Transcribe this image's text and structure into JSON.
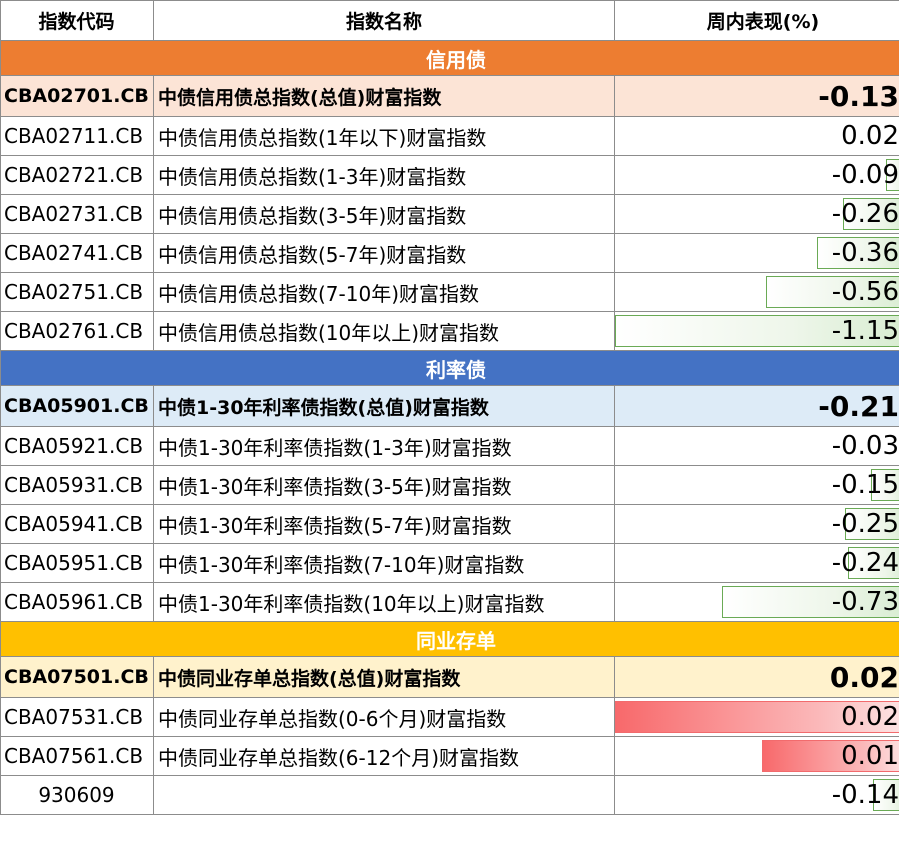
{
  "header": {
    "col_code": "指数代码",
    "col_name": "指数名称",
    "col_perf": "周内表现(%)"
  },
  "sections": [
    {
      "title": "信用债",
      "total": {
        "code": "CBA02701.CB",
        "name": "中债信用债总指数(总值)财富指数",
        "value": "-0.13"
      },
      "rows": [
        {
          "code": "CBA02711.CB",
          "name": "中债信用债总指数(1年以下)财富指数",
          "value": "0.02",
          "num": 0.02
        },
        {
          "code": "CBA02721.CB",
          "name": "中债信用债总指数(1-3年)财富指数",
          "value": "-0.09",
          "num": -0.09
        },
        {
          "code": "CBA02731.CB",
          "name": "中债信用债总指数(3-5年)财富指数",
          "value": "-0.26",
          "num": -0.26
        },
        {
          "code": "CBA02741.CB",
          "name": "中债信用债总指数(5-7年)财富指数",
          "value": "-0.36",
          "num": -0.36
        },
        {
          "code": "CBA02751.CB",
          "name": "中债信用债总指数(7-10年)财富指数",
          "value": "-0.56",
          "num": -0.56
        },
        {
          "code": "CBA02761.CB",
          "name": "中债信用债总指数(10年以上)财富指数",
          "value": "-1.15",
          "num": -1.15
        }
      ]
    },
    {
      "title": "利率债",
      "total": {
        "code": "CBA05901.CB",
        "name": "中债1-30年利率债指数(总值)财富指数",
        "value": "-0.21"
      },
      "rows": [
        {
          "code": "CBA05921.CB",
          "name": "中债1-30年利率债指数(1-3年)财富指数",
          "value": "-0.03",
          "num": -0.03
        },
        {
          "code": "CBA05931.CB",
          "name": "中债1-30年利率债指数(3-5年)财富指数",
          "value": "-0.15",
          "num": -0.15
        },
        {
          "code": "CBA05941.CB",
          "name": "中债1-30年利率债指数(5-7年)财富指数",
          "value": "-0.25",
          "num": -0.25
        },
        {
          "code": "CBA05951.CB",
          "name": "中债1-30年利率债指数(7-10年)财富指数",
          "value": "-0.24",
          "num": -0.24
        },
        {
          "code": "CBA05961.CB",
          "name": "中债1-30年利率债指数(10年以上)财富指数",
          "value": "-0.73",
          "num": -0.73
        }
      ]
    },
    {
      "title": "同业存单",
      "total": {
        "code": "CBA07501.CB",
        "name": "中债同业存单总指数(总值)财富指数",
        "value": "0.02"
      },
      "rows": [
        {
          "code": "CBA07531.CB",
          "name": "中债同业存单总指数(0-6个月)财富指数",
          "value": "0.02",
          "num": 0.02
        },
        {
          "code": "CBA07561.CB",
          "name": "中债同业存单总指数(6-12个月)财富指数",
          "value": "0.01",
          "num": 0.01
        }
      ]
    }
  ],
  "extra_row": {
    "code": "930609",
    "name": "",
    "value": "-0.14",
    "num": -0.14
  },
  "colors": {
    "credit": "#ED7D31",
    "rate": "#4472C4",
    "ncd": "#FFC000",
    "neg_bar": "#6aaa55",
    "pos_bar": "#f8696b"
  }
}
